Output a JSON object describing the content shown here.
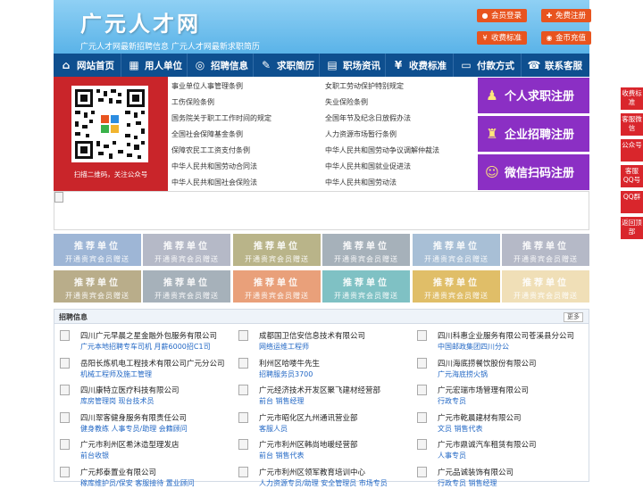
{
  "header": {
    "logo": "广元人才网",
    "subline": "广元人才网最新招聘信息   广元人才网最新求职简历",
    "buttons": [
      {
        "label": "会员登录",
        "icon": "user-icon"
      },
      {
        "label": "免费注册",
        "icon": "register-icon"
      },
      {
        "label": "收费标准",
        "icon": "yen-icon"
      },
      {
        "label": "金币充值",
        "icon": "coin-icon"
      }
    ]
  },
  "nav": {
    "items": [
      {
        "label": "网站首页",
        "icon": "home-icon"
      },
      {
        "label": "用人单位",
        "icon": "building-icon"
      },
      {
        "label": "招聘信息",
        "icon": "broadcast-icon"
      },
      {
        "label": "求职简历",
        "icon": "resume-icon"
      },
      {
        "label": "职场资讯",
        "icon": "news-icon"
      },
      {
        "label": "收费标准",
        "icon": "yen-icon"
      },
      {
        "label": "付款方式",
        "icon": "card-icon"
      },
      {
        "label": "联系客服",
        "icon": "phone-icon"
      }
    ]
  },
  "qr": {
    "caption": "扫描二维码，关注公众号"
  },
  "laws": {
    "left": [
      "事业单位人事管理条例",
      "工伤保险条例",
      "国务院关于职工工作时间的规定",
      "全国社会保障基金条例",
      "保障农民工工资支付条例",
      "中华人民共和国劳动合同法",
      "中华人民共和国社会保险法"
    ],
    "right": [
      "女职工劳动保护特别规定",
      "失业保险条例",
      "全国年节及纪念日放假办法",
      "人力资源市场暂行条例",
      "中华人民共和国劳动争议调解仲裁法",
      "中华人民共和国就业促进法",
      "中华人民共和国劳动法"
    ]
  },
  "register": [
    {
      "label": "个人求职注册",
      "icon": "person-icon"
    },
    {
      "label": "企业招聘注册",
      "icon": "company-icon"
    },
    {
      "label": "微信扫码注册",
      "icon": "wechat-icon"
    }
  ],
  "promo": {
    "title": "推荐单位",
    "subtitle": "开通贵宾会员赠送",
    "colors": [
      "#9eb6d6",
      "#b5b9c7",
      "#b9b489",
      "#a6b1ba",
      "#a8bfd6",
      "#b5b9c7",
      "#b9ad8a",
      "#a6b1ba",
      "#e9a07a",
      "#7fc1c4",
      "#e0be68",
      "#f0dfb7"
    ]
  },
  "jobs": {
    "title": "招聘信息",
    "more": "更多",
    "columns": [
      [
        {
          "company": "四川广元早晨之星金融外包服务有限公司",
          "positions": "广元本地招聘专车司机 月薪6000招C1司"
        },
        {
          "company": "岳阳长炼机电工程技术有限公司广元分公司",
          "positions": "机械工程师及施工管理"
        },
        {
          "company": "四川康特立医疗科技有限公司",
          "positions": "库房管理岗  现台技术员"
        },
        {
          "company": "四川翠客健身服务有限责任公司",
          "positions": "健身教练  人事专员/助理  会籍顾问"
        },
        {
          "company": "广元市利州区希沐造型理发店",
          "positions": "前台收银"
        },
        {
          "company": "广元邦泰置业有限公司",
          "positions": "稼库维护员/保安  客服接待  置业顾问"
        }
      ],
      [
        {
          "company": "成都国卫信安信息技术有限公司",
          "positions": "网络运维工程师"
        },
        {
          "company": "利州区哈喽牛先生",
          "positions": "招聘服务员3700"
        },
        {
          "company": "广元经济技术开发区聚飞建材经营部",
          "positions": "前台  销售经理"
        },
        {
          "company": "广元市昭化区九州通讯营业部",
          "positions": "客服人员"
        },
        {
          "company": "广元市利州区韩尚地暖经营部",
          "positions": "前台  销售代表"
        },
        {
          "company": "广元市利州区领军教育培训中心",
          "positions": "人力资源专员/助理  安全管理员  市场专员"
        }
      ],
      [
        {
          "company": "四川科惠企业服务有限公司苍溪县分公司",
          "positions": "中国邮政集团四川分公"
        },
        {
          "company": "四川海底捞餐饮股份有限公司",
          "positions": "广元海底捞火锅"
        },
        {
          "company": "广元宏瑞市场管理有限公司",
          "positions": "行政专员"
        },
        {
          "company": "广元市乾晨建材有限公司",
          "positions": "文员  销售代表"
        },
        {
          "company": "广元市鼎诚汽车租赁有限公司",
          "positions": "人事专员"
        },
        {
          "company": "广元品诚装饰有限公司",
          "positions": "行政专员  销售经理"
        }
      ]
    ]
  },
  "side": {
    "items": [
      {
        "label": "收费标准"
      },
      {
        "label": "客服微信"
      },
      {
        "label": "公众号"
      },
      {
        "label": "客服QQ号"
      },
      {
        "label": "QQ群"
      },
      {
        "label": "返回顶部"
      }
    ]
  }
}
